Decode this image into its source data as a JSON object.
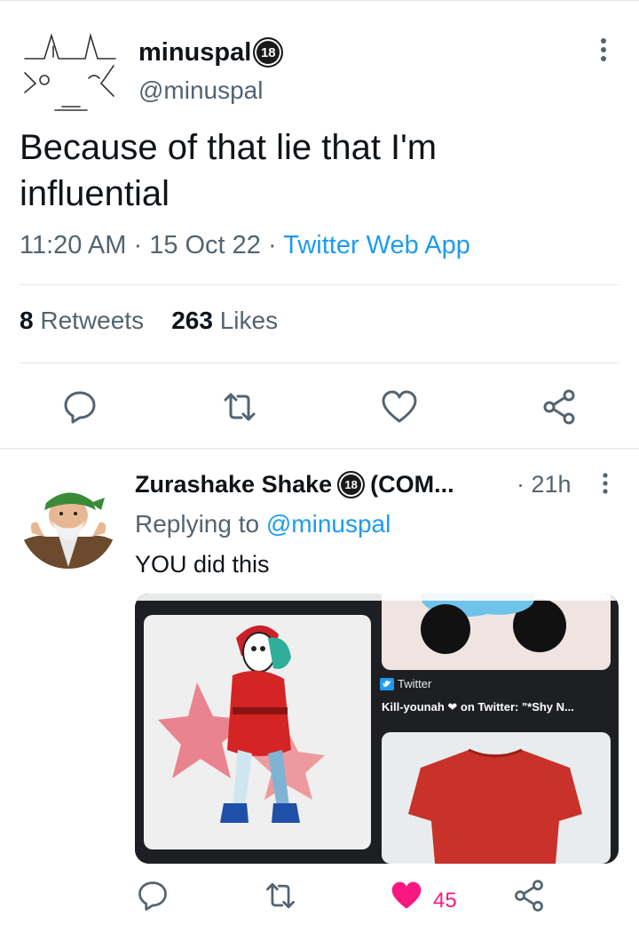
{
  "tweet": {
    "display_name": "minuspal",
    "age_badge": "18",
    "handle": "@minuspal",
    "text_line1": "Because of that lie that I'm",
    "text_line2": "influential",
    "time": "11:20 AM",
    "date": "15 Oct 22",
    "source": "Twitter Web App",
    "retweets_count": "8",
    "retweets_label": "Retweets",
    "likes_count": "263",
    "likes_label": "Likes",
    "meta_separator": "·"
  },
  "reply": {
    "display_name": "Zurashake Shake",
    "age_badge": "18",
    "name_suffix": "(COM...",
    "time": "· 21h",
    "replying_prefix": "Replying to",
    "replying_to": "@minuspal",
    "text": "YOU did this",
    "media": {
      "card_source": "Twitter",
      "card_title": "Kill-younah ❤ on Twitter: \"*Shy N..."
    },
    "like_count": "45"
  },
  "colors": {
    "accent": "#1d9bf0",
    "secondary_text": "#536471",
    "like_pink": "#f91880",
    "shy_guy_red": "#d42424",
    "shirt_red": "#c8322a"
  },
  "icons": [
    "more-vertical-icon",
    "reply-icon",
    "retweet-icon",
    "like-icon",
    "share-icon",
    "twitter-bird-icon"
  ]
}
